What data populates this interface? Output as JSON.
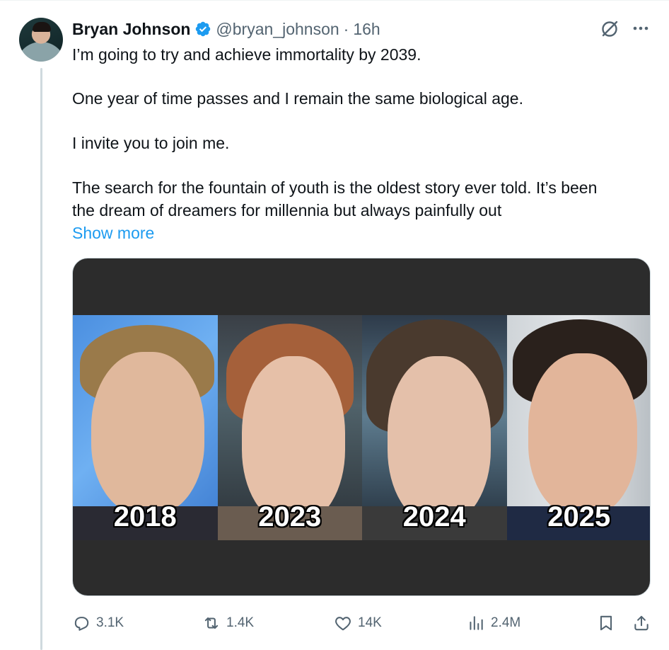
{
  "author": {
    "name": "Bryan Johnson",
    "handle": "@bryan_johnson",
    "time_separator": "·",
    "time": "16h"
  },
  "post": {
    "paragraphs": [
      "I’m going to try and achieve immortality by 2039.",
      "One year of time passes and I remain the same biological age.",
      "I invite you to join me.",
      "The search for the fountain of youth is the oldest story ever told. It’s been",
      "the dream of dreamers for millennia but always painfully out"
    ],
    "show_more": "Show more"
  },
  "media": {
    "photos": [
      {
        "year": "2018"
      },
      {
        "year": "2023"
      },
      {
        "year": "2024"
      },
      {
        "year": "2025"
      }
    ]
  },
  "actions": {
    "replies": "3.1K",
    "reposts": "1.4K",
    "likes": "14K",
    "views": "2.4M"
  },
  "colors": {
    "accent": "#1d9bf0",
    "muted": "#536471",
    "text": "#0f1419"
  },
  "icons": [
    "verified-badge-icon",
    "grok-icon",
    "more-icon",
    "reply-icon",
    "repost-icon",
    "like-icon",
    "views-icon",
    "bookmark-icon",
    "share-icon"
  ]
}
